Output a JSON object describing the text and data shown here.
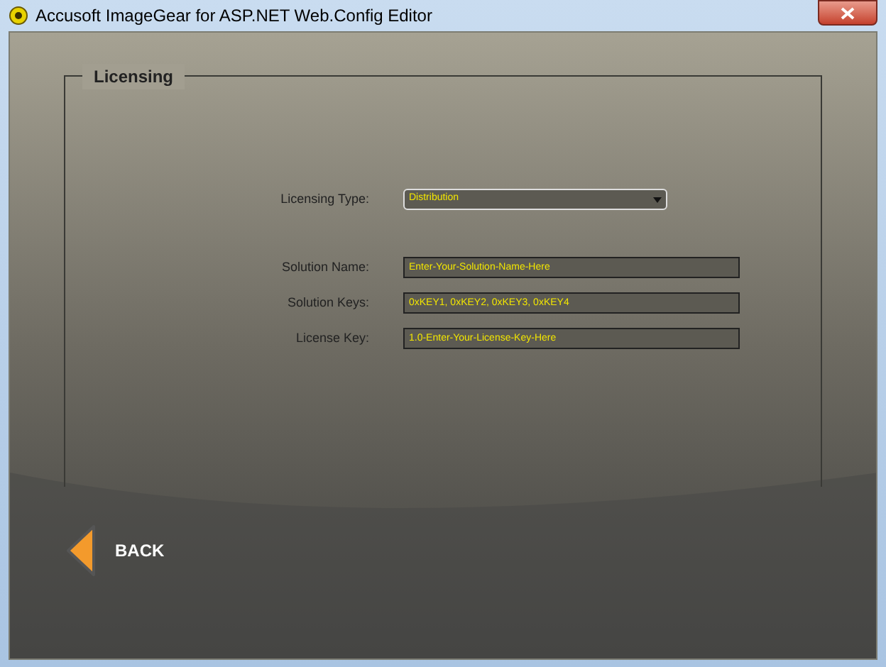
{
  "window": {
    "title": "Accusoft ImageGear for ASP.NET Web.Config Editor"
  },
  "group": {
    "title": "Licensing"
  },
  "fields": [
    {
      "kind": "dropdown",
      "label": "Licensing Type:",
      "value": "Distribution"
    },
    {
      "kind": "text",
      "label": "Solution Name:",
      "value": "Enter-Your-Solution-Name-Here"
    },
    {
      "kind": "text",
      "label": "Solution Keys:",
      "value": "0xKEY1, 0xKEY2, 0xKEY3, 0xKEY4"
    },
    {
      "kind": "text",
      "label": "License Key:",
      "value": "1.0-Enter-Your-License-Key-Here"
    }
  ],
  "back_button": {
    "label": "BACK"
  }
}
